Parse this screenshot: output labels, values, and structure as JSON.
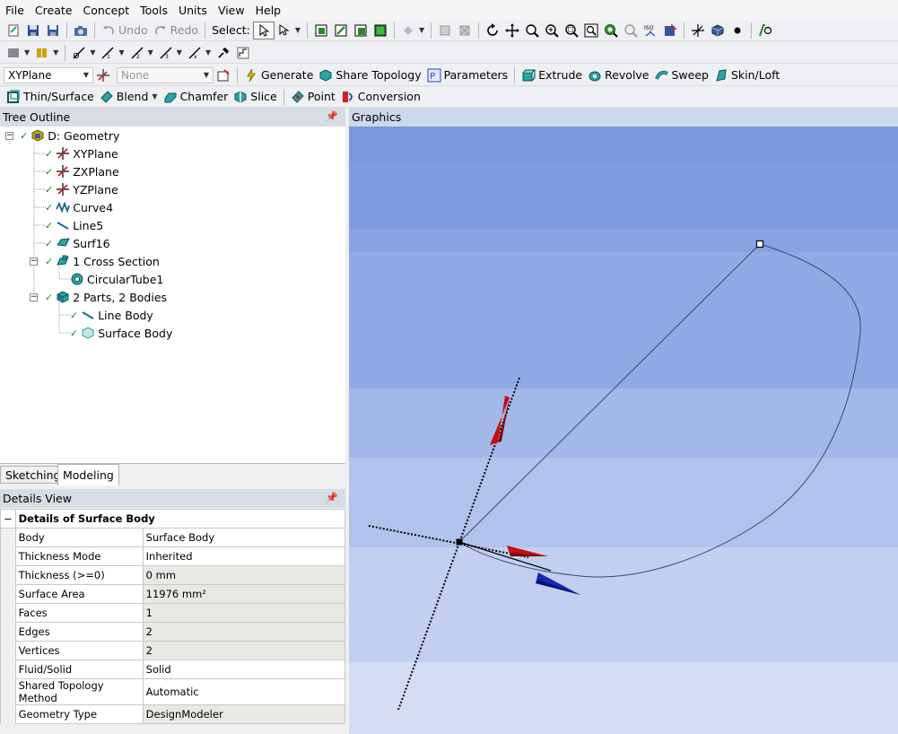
{
  "menu": [
    "File",
    "Create",
    "Concept",
    "Tools",
    "Units",
    "View",
    "Help"
  ],
  "toolbar1": {
    "undo_label": "Undo",
    "redo_label": "Redo",
    "select_label": "Select:"
  },
  "toolbar3": {
    "plane_value": "XYPlane",
    "sketch_value": "None",
    "generate_label": "Generate",
    "share_topology_label": "Share Topology",
    "parameters_label": "Parameters",
    "extrude_label": "Extrude",
    "revolve_label": "Revolve",
    "sweep_label": "Sweep",
    "skinloft_label": "Skin/Loft"
  },
  "toolbar4": {
    "thin_surface_label": "Thin/Surface",
    "blend_label": "Blend",
    "chamfer_label": "Chamfer",
    "slice_label": "Slice",
    "point_label": "Point",
    "conversion_label": "Conversion"
  },
  "tree_panel": {
    "title": "Tree Outline",
    "pin": "4"
  },
  "tree": [
    {
      "label": "D: Geometry",
      "icon": "geometry-icon"
    },
    {
      "label": "XYPlane",
      "icon": "plane-icon"
    },
    {
      "label": "ZXPlane",
      "icon": "plane-icon"
    },
    {
      "label": "YZPlane",
      "icon": "plane-icon"
    },
    {
      "label": "Curve4",
      "icon": "curve-icon"
    },
    {
      "label": "Line5",
      "icon": "line-icon"
    },
    {
      "label": "Surf16",
      "icon": "surface-icon"
    },
    {
      "label": "1 Cross Section",
      "icon": "cross-section-icon"
    },
    {
      "label": "CircularTube1",
      "icon": "circular-tube-icon"
    },
    {
      "label": "2 Parts, 2 Bodies",
      "icon": "parts-icon"
    },
    {
      "label": "Line Body",
      "icon": "line-body-icon"
    },
    {
      "label": "Surface Body",
      "icon": "surface-body-icon"
    }
  ],
  "tabs": {
    "sketching": "Sketching",
    "modeling": "Modeling"
  },
  "details_panel": {
    "title": "Details View",
    "header": "Details of Surface Body",
    "rows": [
      {
        "key": "Body",
        "value": "Surface Body"
      },
      {
        "key": "Thickness Mode",
        "value": "Inherited"
      },
      {
        "key": "Thickness (>=0)",
        "value": "0 mm"
      },
      {
        "key": "Surface Area",
        "value": "11976 mm²"
      },
      {
        "key": "Faces",
        "value": "1"
      },
      {
        "key": "Edges",
        "value": "2"
      },
      {
        "key": "Vertices",
        "value": "2"
      },
      {
        "key": "Fluid/Solid",
        "value": "Solid"
      },
      {
        "key": "Shared Topology Method",
        "value": "Automatic"
      },
      {
        "key": "Geometry Type",
        "value": "DesignModeler"
      }
    ]
  },
  "graphics": {
    "title": "Graphics"
  },
  "colors": {
    "graphics_top": "#7b98df",
    "graphics_bottom": "#dfe6f5",
    "axis_red": "#c41010",
    "axis_blue": "#1626b0",
    "check_green": "#138a1e",
    "panel_header": "#d6dde6"
  }
}
